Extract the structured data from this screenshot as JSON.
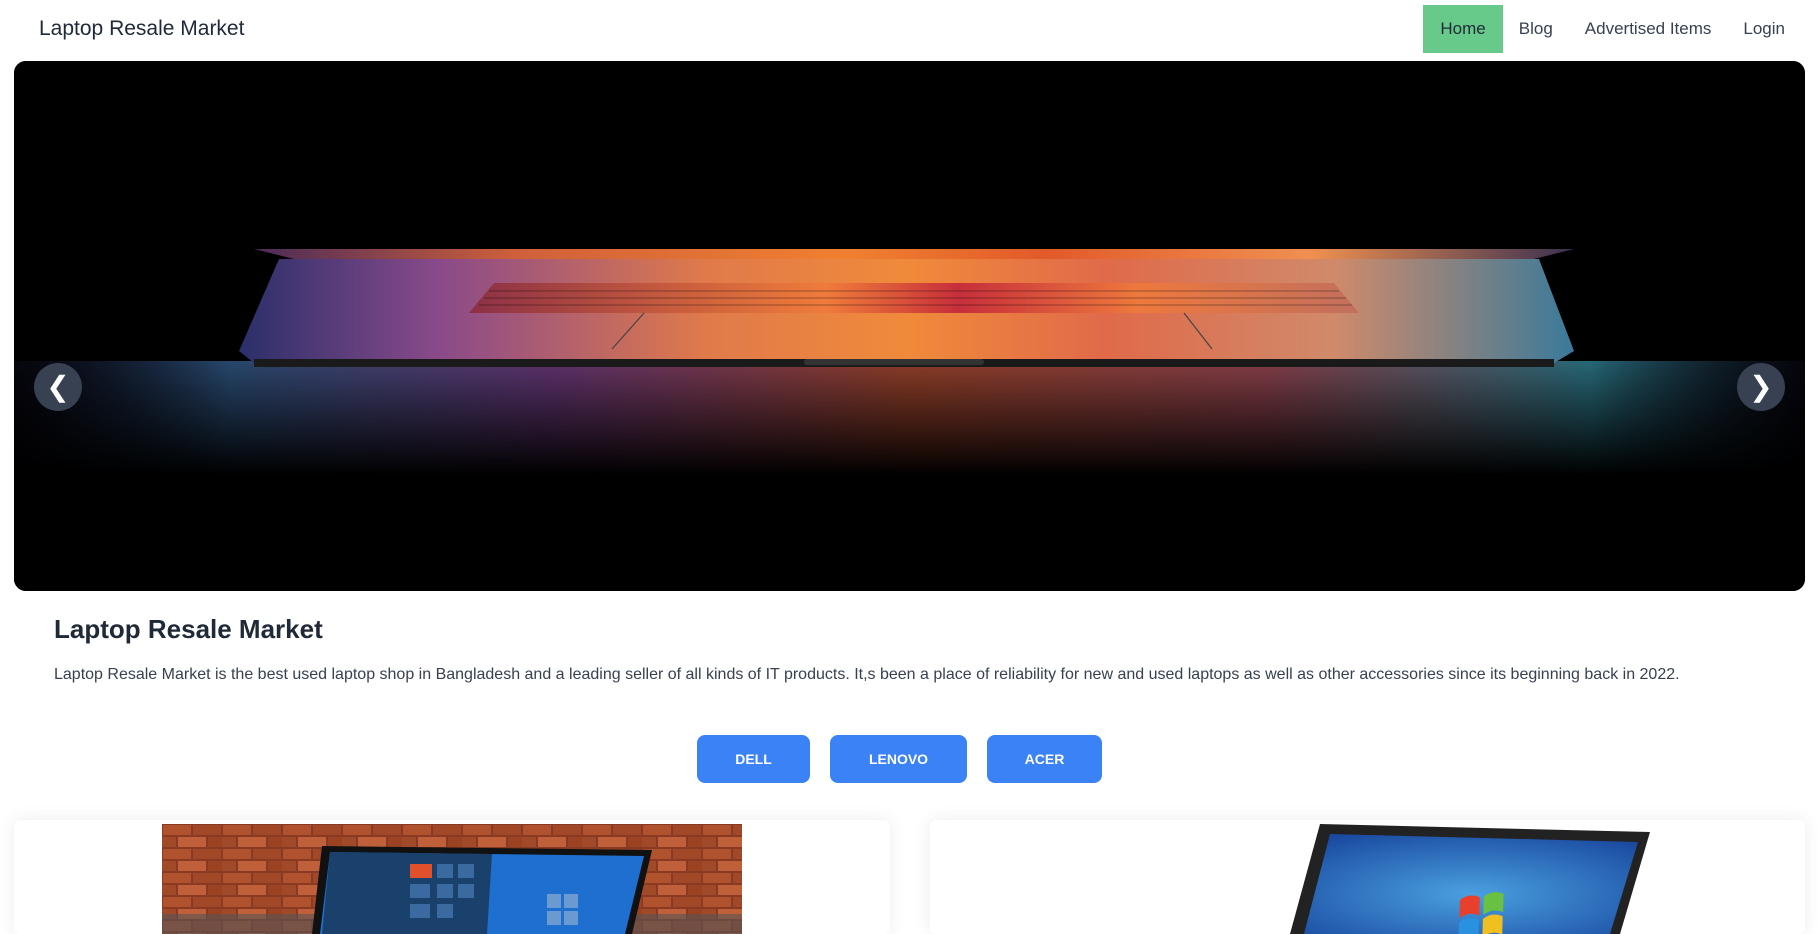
{
  "nav": {
    "brand": "Laptop Resale Market",
    "items": [
      {
        "label": "Home",
        "active": true
      },
      {
        "label": "Blog",
        "active": false
      },
      {
        "label": "Advertised Items",
        "active": false
      },
      {
        "label": "Login",
        "active": false
      }
    ]
  },
  "carousel": {
    "prev_label": "❮",
    "next_label": "❯"
  },
  "about": {
    "title": "Laptop Resale Market",
    "text": "Laptop Resale Market is the best used laptop shop in Bangladesh and a leading seller of all kinds of IT products. It,s been a place of reliability for new and used laptops as well as other accessories since its beginning back in 2022."
  },
  "brands": {
    "dell": "DELL",
    "lenovo": "LENOVO",
    "acer": "ACER"
  },
  "colors": {
    "active_nav": "#67c98a",
    "button_blue": "#3b82f6",
    "carousel_control": "#374151"
  }
}
